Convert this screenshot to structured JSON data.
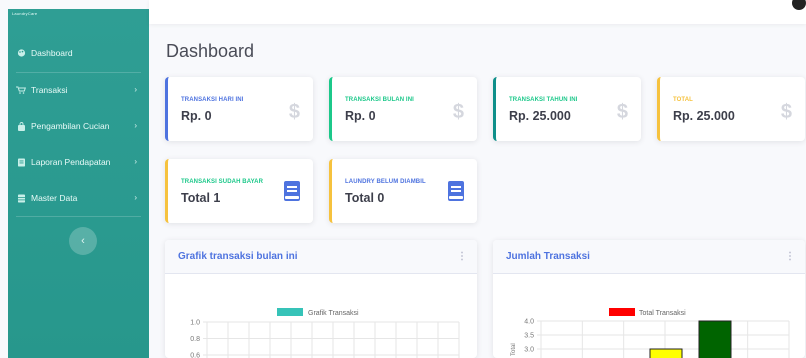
{
  "sidebar": {
    "brand": "LaundryCare",
    "items": [
      {
        "label": "Dashboard",
        "icon": "palette-icon"
      },
      {
        "label": "Transaksi",
        "icon": "cart-icon"
      },
      {
        "label": "Pengambilan Cucian",
        "icon": "bag-icon"
      },
      {
        "label": "Laporan Pendapatan",
        "icon": "report-icon"
      },
      {
        "label": "Master Data",
        "icon": "database-icon"
      }
    ],
    "toggle_glyph": "‹"
  },
  "page": {
    "title": "Dashboard"
  },
  "cards": [
    {
      "label": "TRANSAKSI HARI INI",
      "value": "Rp. 0",
      "color": "#4e73df",
      "icon": "dollar-icon"
    },
    {
      "label": "TRANSAKSI BULAN INI",
      "value": "Rp. 0",
      "color": "#1cc88a",
      "icon": "dollar-icon"
    },
    {
      "label": "TRANSAKSI TAHUN INI",
      "value": "Rp. 25.000",
      "color": "#1cc88a",
      "border": "#0f8f8a",
      "icon": "dollar-icon"
    },
    {
      "label": "TOTAL",
      "value": "Rp. 25.000",
      "color": "#f6c23e",
      "icon": "dollar-icon"
    },
    {
      "label": "TRANSAKSI SUDAH BAYAR",
      "value": "Total 1",
      "color": "#1cc88a",
      "border": "#f6c23e",
      "icon": "book-icon"
    },
    {
      "label": "LAUNDRY BELUM DIAMBIL",
      "value": "Total 0",
      "color": "#4e73df",
      "border": "#f6c23e",
      "icon": "book-icon"
    }
  ],
  "panels": [
    {
      "title": "Grafik transaksi bulan ini",
      "menu": "⋮"
    },
    {
      "title": "Jumlah Transaksi",
      "menu": "⋮"
    }
  ],
  "chart_data": [
    {
      "type": "line",
      "legend": [
        "Grafik Transaksi"
      ],
      "legend_placement": "top",
      "series": [
        {
          "name": "Grafik Transaksi",
          "color": "#36c3b8",
          "values": []
        }
      ],
      "y_ticks": [
        "1.0",
        "0.8",
        "0.6"
      ],
      "ylim": [
        0,
        1.0
      ],
      "grid": true
    },
    {
      "type": "bar",
      "legend": [
        "Total Transaksi"
      ],
      "legend_placement": "top",
      "ylabel": "Total",
      "y_ticks": [
        "4.0",
        "3.5",
        "3.0"
      ],
      "ylim": [
        0,
        4.0
      ],
      "bars": [
        {
          "value": 3.0,
          "color": "#ffff00"
        },
        {
          "value": 4.0,
          "color": "#006400"
        }
      ],
      "legend_color": "#ff0000",
      "grid": true
    }
  ]
}
